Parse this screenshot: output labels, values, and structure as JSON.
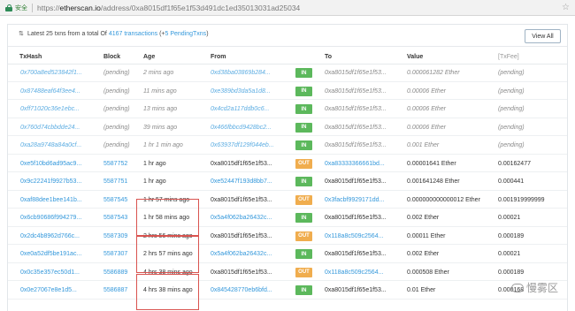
{
  "browser": {
    "secure_label": "安全",
    "url_scheme": "https://",
    "url_host": "etherscan.io",
    "url_path": "/address/0xa8015df1f65e1f53d491dc1ed35013031ad25034"
  },
  "panel": {
    "summary_prefix": "Latest 25 txns from a total Of ",
    "summary_link": "4167 transactions",
    "summary_mid": " (+",
    "summary_pending": "5 PendingTxns",
    "summary_suffix": ")",
    "view_all": "View All"
  },
  "table": {
    "headers": {
      "txhash": "TxHash",
      "block": "Block",
      "age": "Age",
      "from": "From",
      "to": "To",
      "value": "Value",
      "fee": "[TxFee]"
    },
    "rows": [
      {
        "hash": "0x700a8ed523842f1...",
        "block": "(pending)",
        "age": "2 mins ago",
        "from": "0xd38ba03869b284...",
        "dir": "IN",
        "to": "0xa8015df1f65e1f53...",
        "value": "0.000061282 Ether",
        "fee": "(pending)",
        "pending": true
      },
      {
        "hash": "0x87488eaf64f3ee4...",
        "block": "(pending)",
        "age": "11 mins ago",
        "from": "0xe389bd3da5a1d8...",
        "dir": "IN",
        "to": "0xa8015df1f65e1f53...",
        "value": "0.00006 Ether",
        "fee": "(pending)",
        "pending": true
      },
      {
        "hash": "0xff71020c36e1ebc...",
        "block": "(pending)",
        "age": "13 mins ago",
        "from": "0x4cd2a117ddb0c6...",
        "dir": "IN",
        "to": "0xa8015df1f65e1f53...",
        "value": "0.00006 Ether",
        "fee": "(pending)",
        "pending": true
      },
      {
        "hash": "0x760d74cbbdde24...",
        "block": "(pending)",
        "age": "39 mins ago",
        "from": "0x466fbbcd9428bc2...",
        "dir": "IN",
        "to": "0xa8015df1f65e1f53...",
        "value": "0.00006 Ether",
        "fee": "(pending)",
        "pending": true
      },
      {
        "hash": "0xa28a9748a84a0cf...",
        "block": "(pending)",
        "age": "1 hr 1 min ago",
        "from": "0x63937df129f044eb...",
        "dir": "IN",
        "to": "0xa8015df1f65e1f53...",
        "value": "0.001 Ether",
        "fee": "(pending)",
        "pending": true
      },
      {
        "hash": "0xe5f10bd6ad95ac9...",
        "block": "5587752",
        "age": "1 hr ago",
        "from": "0xa8015df1f65e1f53...",
        "dir": "OUT",
        "to": "0xa83333366661bd...",
        "value": "0.00001641 Ether",
        "fee": "0.00162477",
        "pending": false
      },
      {
        "hash": "0x9c22241f9927b53...",
        "block": "5587751",
        "age": "1 hr ago",
        "from": "0xe52447f193d8bb7...",
        "dir": "IN",
        "to": "0xa8015df1f65e1f53...",
        "value": "0.001641248 Ether",
        "fee": "0.000441",
        "pending": false
      },
      {
        "hash": "0xaf88dee1bee141b...",
        "block": "5587545",
        "age": "1 hr 57 mins ago",
        "from": "0xa8015df1f65e1f53...",
        "dir": "OUT",
        "to": "0x3facbf9929171dd...",
        "value": "0.000000000000012 Ether",
        "fee": "0.001919999999",
        "pending": false
      },
      {
        "hash": "0x6cb90686f994279...",
        "block": "5587543",
        "age": "1 hr 58 mins ago",
        "from": "0x5a4f062ba26432c...",
        "dir": "IN",
        "to": "0xa8015df1f65e1f53...",
        "value": "0.002 Ether",
        "fee": "0.00021",
        "pending": false
      },
      {
        "hash": "0x2dc4b8962d766c...",
        "block": "5587309",
        "age": "2 hrs 56 mins ago",
        "from": "0xa8015df1f65e1f53...",
        "dir": "OUT",
        "to": "0x118a8c509c2564...",
        "value": "0.00011 Ether",
        "fee": "0.000189",
        "pending": false
      },
      {
        "hash": "0xe0a52df5be191ac...",
        "block": "5587307",
        "age": "2 hrs 57 mins ago",
        "from": "0x5a4f062ba26432c...",
        "dir": "IN",
        "to": "0xa8015df1f65e1f53...",
        "value": "0.002 Ether",
        "fee": "0.00021",
        "pending": false
      },
      {
        "hash": "0x0c35e357ec50d1...",
        "block": "5586889",
        "age": "4 hrs 38 mins ago",
        "from": "0xa8015df1f65e1f53...",
        "dir": "OUT",
        "to": "0x118a8c509c2564...",
        "value": "0.000508 Ether",
        "fee": "0.000189",
        "pending": false
      },
      {
        "hash": "0x0e27067e8e1d5...",
        "block": "5586887",
        "age": "4 hrs 38 mins ago",
        "from": "0x845428770eb6bfd...",
        "dir": "IN",
        "to": "0xa8015df1f65e1f53...",
        "value": "0.01 Ether",
        "fee": "0.000168",
        "pending": false
      }
    ]
  },
  "watermark": {
    "text": "慢雾区"
  },
  "colors": {
    "link": "#3498db",
    "in_badge": "#5cb85c",
    "out_badge": "#f0ad4e",
    "highlight_border": "#d9534f"
  }
}
